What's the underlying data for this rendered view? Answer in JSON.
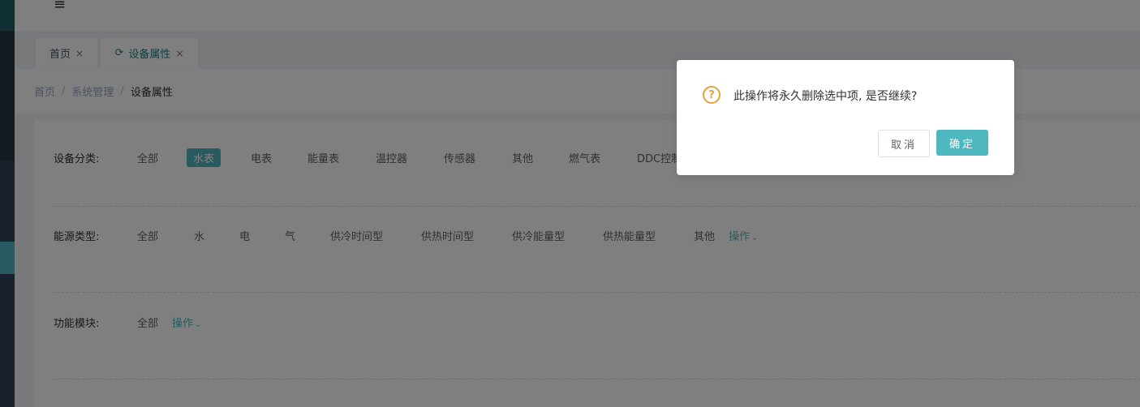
{
  "header": {
    "menu_icon": "hamburger-icon"
  },
  "tags": {
    "home_label": "首页",
    "active_label": "设备属性",
    "close_glyph": "×",
    "refresh_icon": "refresh-icon"
  },
  "breadcrumb": {
    "items": [
      "首页",
      "系统管理",
      "设备属性"
    ],
    "separator": "/"
  },
  "filters": {
    "device_category": {
      "label": "设备分类:",
      "options": [
        "全部",
        "水表",
        "电表",
        "能量表",
        "温控器",
        "传感器",
        "其他",
        "燃气表",
        "DDC控制"
      ],
      "selected": "水表"
    },
    "energy_type": {
      "label": "能源类型:",
      "options": [
        "全部",
        "水",
        "电",
        "气",
        "供冷时间型",
        "供热时间型",
        "供冷能量型",
        "供热能量型",
        "其他"
      ],
      "operate": "操作"
    },
    "function_module": {
      "label": "功能模块:",
      "options": [
        "全部"
      ],
      "operate": "操作"
    }
  },
  "dialog": {
    "icon": "question-icon",
    "message": "此操作将永久删除选中项, 是否继续?",
    "cancel_label": "取消",
    "confirm_label": "确定"
  },
  "colors": {
    "accent": "#4fb7c0",
    "warning": "#e6a23c",
    "sidebar": "#304156"
  }
}
